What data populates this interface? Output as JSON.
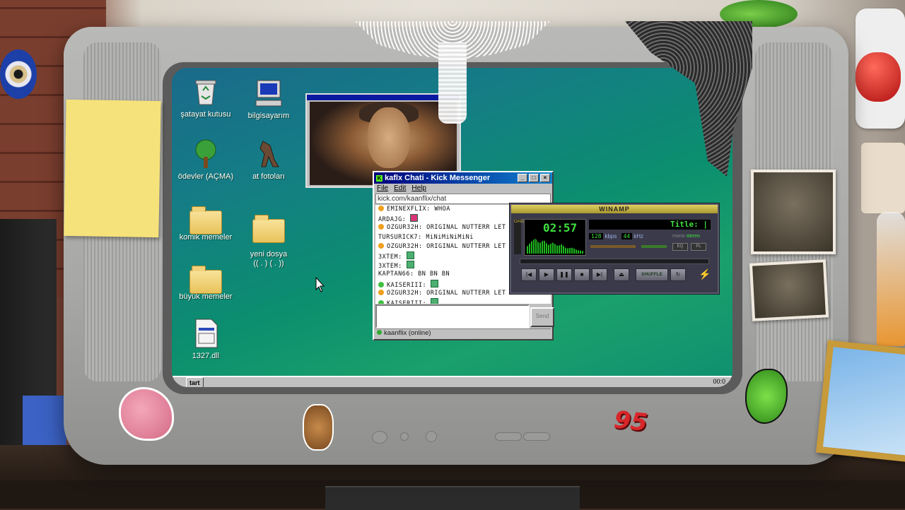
{
  "desktop": {
    "icons": [
      {
        "label": "şatayat kutusu",
        "icon": "recycle-bin-icon"
      },
      {
        "label": "bilgisayarım",
        "icon": "computer-icon"
      },
      {
        "label": "ödevler (AÇMA)",
        "icon": "tree-icon"
      },
      {
        "label": "at fotoları",
        "icon": "horse-icon"
      },
      {
        "label": "komik memeler",
        "icon": "folder-icon"
      },
      {
        "label": "yeni dosya\n(( . ) ( . ))",
        "icon": "folder-icon"
      },
      {
        "label": "büyük memeler",
        "icon": "folder-icon"
      },
      {
        "label": "1327.dll",
        "icon": "dll-file-icon"
      }
    ]
  },
  "chat_window": {
    "title": "kaflx Chati - Kick Messenger",
    "menu": [
      "File",
      "Edit",
      "Help"
    ],
    "address": "kick.com/kaanflix/chat",
    "messages": [
      {
        "text": "EMINEXFLIX: WHOA",
        "color": "#f0a020"
      },
      {
        "text": "ARDAJG:",
        "color": "",
        "emote": "#d8337a"
      },
      {
        "text": "OZGUR32H: ORIGINAL NUTTERR LET",
        "color": "#f0a020"
      },
      {
        "text": "TURSURICK7: MiNiMiNiMiNi",
        "color": ""
      },
      {
        "text": "OZGUR32H: ORIGINAL NUTTERR LET",
        "color": "#f0a020"
      },
      {
        "text": "3XTEM:",
        "color": "",
        "emote": "#4caf70"
      },
      {
        "text": "3XTEM:",
        "color": "",
        "emote": "#4caf70"
      },
      {
        "text": "KAPTAN66: BN BN BN",
        "color": ""
      },
      {
        "text": "KAISERIII:",
        "color": "#40c040",
        "emote": "#4caf70"
      },
      {
        "text": "OZGUR32H: ORIGINAL NUTTERR LET",
        "color": "#f0a020"
      },
      {
        "text": "KAISERIII:",
        "color": "#40c040",
        "emote": "#4caf70"
      }
    ],
    "send_label": "Send",
    "status": "kaanflix (online)"
  },
  "winamp": {
    "title": "WINAMP",
    "time": "02:57",
    "song_title": "Title: |",
    "bitrate": "128",
    "kbps_label": "kbps",
    "khz": "44",
    "khz_label": "kHz",
    "mono_label": "mono",
    "stereo_label": "stereo",
    "eq_label": "EQ",
    "pl_label": "PL",
    "shuffle_label": "SHUFFLE",
    "side_label": "OAIDV",
    "controls": [
      "prev",
      "play",
      "pause",
      "stop",
      "next",
      "eject"
    ]
  },
  "taskbar": {
    "start_label": "tart",
    "clock": "00:0"
  },
  "decor": {
    "sticker_text": "95"
  }
}
